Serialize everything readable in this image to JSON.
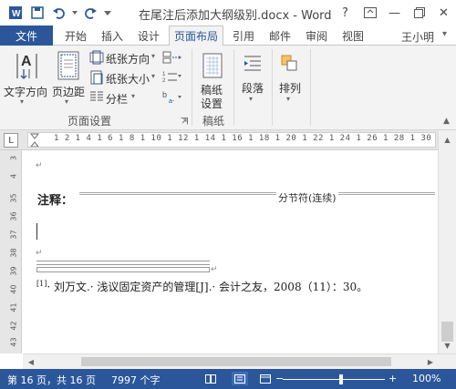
{
  "titlebar": {
    "title": "在尾注后添加大纲级别.docx - Word",
    "help": "?",
    "minimize": "—",
    "close": "✕"
  },
  "tabs": {
    "file": "文件",
    "items": [
      "开始",
      "插入",
      "设计",
      "页面布局",
      "引用",
      "邮件",
      "审阅",
      "视图"
    ],
    "active": "页面布局",
    "user": "王小明"
  },
  "ribbon": {
    "text_direction": "文字方向",
    "margins": "页边距",
    "orientation": "纸张方向",
    "size": "纸张大小",
    "columns": "分栏",
    "page_setup_group": "页面设置",
    "manuscript_line1": "稿纸",
    "manuscript_line2": "设置",
    "manuscript_group": "稿纸",
    "paragraph": "段落",
    "arrange": "排列"
  },
  "ruler": {
    "corner": "L",
    "horizontal": "1 2 1 4 1 6 1 8 1 10 1 12 1 14 1 16 1 18 1 20 1 22 1 24 1 26 1 28 1 30 1",
    "vertical": [
      "3",
      "4",
      "35",
      "36",
      "37",
      "38",
      "39",
      "40",
      "41",
      "42",
      "43"
    ]
  },
  "document": {
    "note_title": "注释：",
    "section_break": "分节符(连续)",
    "endnote_marker": "[1]",
    "endnote_text": "· 刘万文.· 浅议固定资产的管理[J].· 会计之友，2008（11）：30。"
  },
  "statusbar": {
    "page": "第 16 页，共 16 页",
    "words": "7997 个字",
    "zoom": "100%"
  },
  "colors": {
    "accent": "#2b579a"
  }
}
